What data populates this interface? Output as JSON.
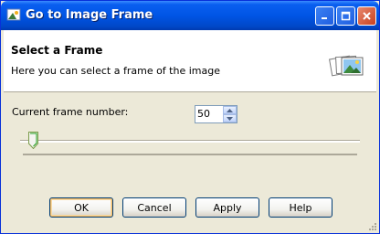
{
  "window": {
    "title": "Go to Image Frame",
    "buttons": [
      "minimize",
      "maximize",
      "close"
    ]
  },
  "header": {
    "title": "Select a Frame",
    "subtitle": "Here you can select a frame of the image",
    "icon": "image-stack-icon"
  },
  "form": {
    "frame_label": "Current frame number:",
    "frame_value": "50"
  },
  "slider": {
    "position_fraction": 0.04
  },
  "buttons": {
    "ok": "OK",
    "cancel": "Cancel",
    "apply": "Apply",
    "help": "Help"
  },
  "colors": {
    "titlebar": "#0055e5",
    "dialog_bg": "#ece9d8",
    "close_button": "#c7401f"
  }
}
